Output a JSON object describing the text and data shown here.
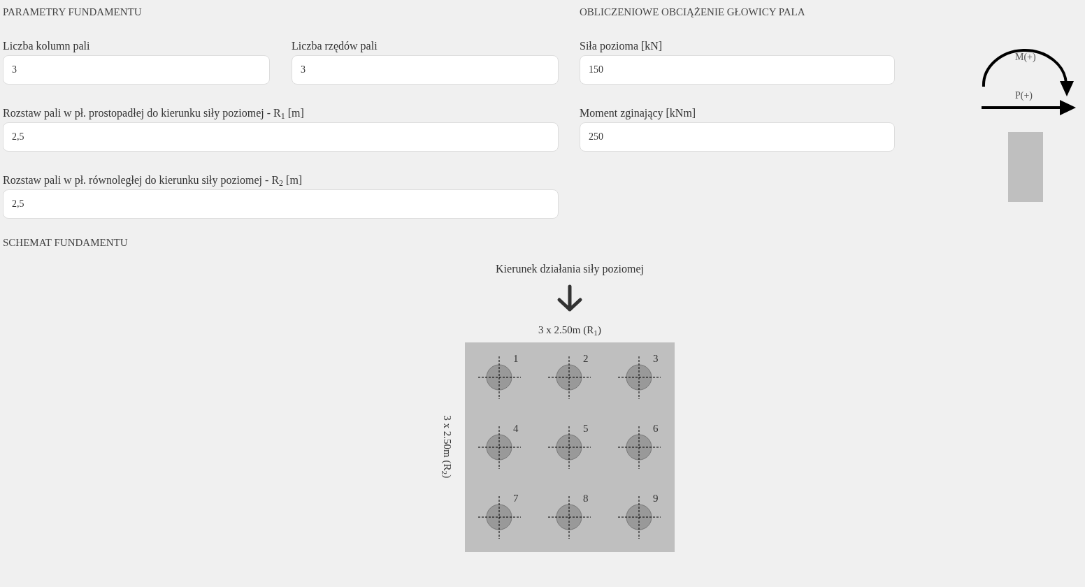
{
  "foundation": {
    "title": "PARAMETRY FUNDAMENTU",
    "fields": [
      {
        "kind": "half",
        "label": "Liczba kolumn pali",
        "value": "3"
      },
      {
        "kind": "half",
        "label": "Liczba rzędów pali",
        "value": "3"
      },
      {
        "kind": "full",
        "label": "Rozstaw pali w pł. prostopadłej do kierunku siły poziomej - R$_{1}$ [m]",
        "value": "2,5"
      },
      {
        "kind": "full",
        "label": "Rozstaw pali w pł. równoległej do kierunku siły poziomej - R$_{2}$ [m]",
        "value": "2,5"
      }
    ]
  },
  "load": {
    "title": "OBLICZENIOWE OBCIĄŻENIE GŁOWICY PALA",
    "fields": [
      {
        "label": "Siła pozioma [kN]",
        "value": "150"
      },
      {
        "label": "Moment zginający [kNm]",
        "value": "250"
      }
    ]
  },
  "sign_convention": {
    "moment_label": "M(+)",
    "force_label": "P(+)"
  },
  "scheme": {
    "title": "SCHEMAT FUNDAMENTU",
    "direction_label": "Kierunek działania siły poziomej",
    "top_dimension": "3 x 2.50m (R$_{1}$)",
    "side_dimension": "3 x 2.50m (R$_{2}$)",
    "piles": [
      "1",
      "2",
      "3",
      "4",
      "5",
      "6",
      "7",
      "8",
      "9"
    ]
  }
}
